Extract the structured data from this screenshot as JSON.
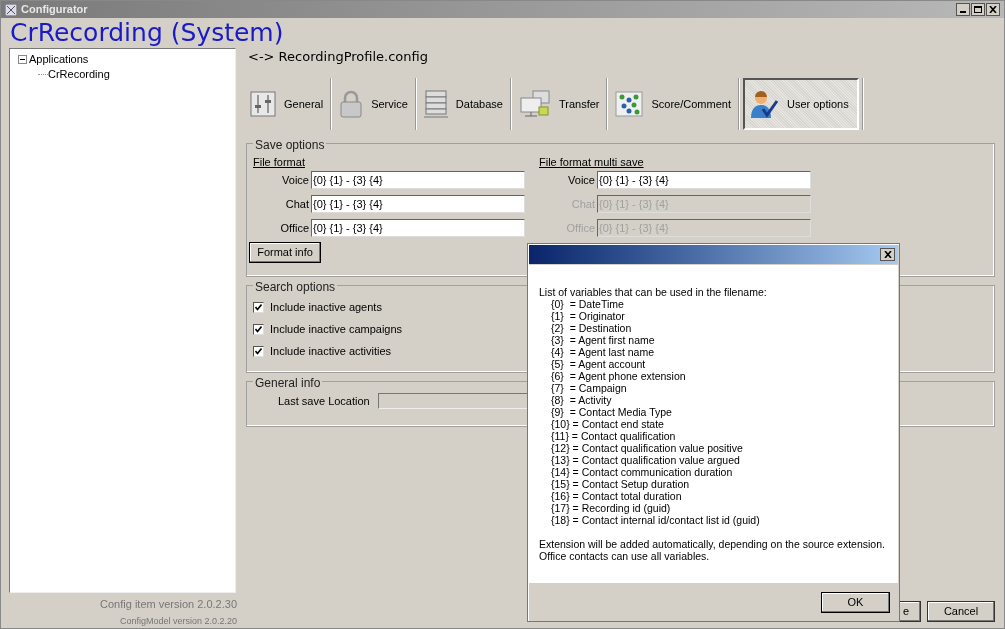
{
  "window": {
    "title": "Configurator"
  },
  "heading": "CrRecording (System)",
  "tree": [
    {
      "label": "Applications",
      "expanded": true,
      "children": [
        {
          "label": "CrRecording"
        }
      ]
    }
  ],
  "file_path": "<-> RecordingProfile.config",
  "toolbar": [
    {
      "label": "General",
      "kind": "sliders",
      "selected": false
    },
    {
      "label": "Service",
      "kind": "lock",
      "selected": false
    },
    {
      "label": "Database",
      "kind": "server",
      "selected": false
    },
    {
      "label": "Transfer",
      "kind": "transfer",
      "selected": false
    },
    {
      "label": "Score/Comment",
      "kind": "grid",
      "selected": false
    },
    {
      "label": "User options",
      "kind": "user",
      "selected": true
    }
  ],
  "save_options": {
    "title": "Save options",
    "groups": [
      {
        "title": "File format",
        "fields": [
          {
            "label": "Voice",
            "value": "{0} {1} - {3} {4}",
            "disabled": false
          },
          {
            "label": "Chat",
            "value": "{0} {1} - {3} {4}",
            "disabled": false
          },
          {
            "label": "Office",
            "value": "{0} {1} - {3} {4}",
            "disabled": false
          }
        ]
      },
      {
        "title": "File format multi save",
        "fields": [
          {
            "label": "Voice",
            "value": "{0} {1} - {3} {4}",
            "disabled": false
          },
          {
            "label": "Chat",
            "value": "{0} {1} - {3} {4}",
            "disabled": true
          },
          {
            "label": "Office",
            "value": "{0} {1} - {3} {4}",
            "disabled": true
          }
        ]
      }
    ],
    "button": "Format info"
  },
  "search_options": {
    "title": "Search options",
    "checkboxes": [
      {
        "label": "Include inactive agents",
        "checked": true
      },
      {
        "label": "Include inactive campaigns",
        "checked": true
      },
      {
        "label": "Include inactive activities",
        "checked": true
      }
    ]
  },
  "general_info": {
    "title": "General info",
    "field_label": "Last save Location"
  },
  "versions": [
    "Config item version 2.0.2.30",
    "ConfigModel version 2.0.2.20"
  ],
  "buttons": [
    "e",
    "Cancel"
  ],
  "dialog": {
    "intro": "List of variables that can be used in the filename:",
    "variables": [
      "{0}  = DateTime",
      "{1}  = Originator",
      "{2}  = Destination",
      "{3}  = Agent first name",
      "{4}  = Agent last name",
      "{5}  = Agent account",
      "{6}  = Agent phone extension",
      "{7}  = Campaign",
      "{8}  = Activity",
      "{9}  = Contact Media Type",
      "{10} = Contact end state",
      "{11} = Contact qualification",
      "{12} = Contact qualification value positive",
      "{13} = Contact qualification value argued",
      "{14} = Contact communication duration",
      "{15} = Contact Setup duration",
      "{16} = Contact total duration",
      "{17} = Recording id (guid)",
      "{18} = Contact internal id/contact list id (guid)"
    ],
    "notes": [
      "Extension will be added automatically, depending on the source extension.",
      "Office contacts can use all variables."
    ],
    "ok": "OK"
  }
}
